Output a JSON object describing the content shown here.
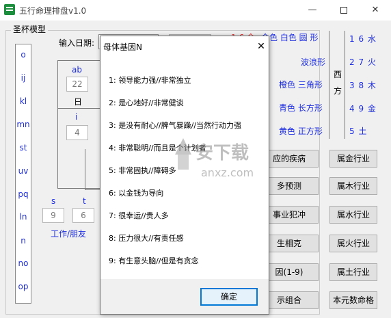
{
  "window": {
    "title": "五行命理排盘v1.0",
    "min_glyph": "—",
    "close_glyph": "✕"
  },
  "model_group": {
    "title": "圣杯模型",
    "left_items": [
      "o",
      "ij",
      "kl",
      "mn",
      "st",
      "uv",
      "pq",
      "ln",
      "n",
      "no",
      "op"
    ]
  },
  "date": {
    "label": "输入日期:"
  },
  "red_text": "1 6 金",
  "calc": {
    "ab_label": "ab",
    "ab_value": "22",
    "day_label": "日",
    "i_label": "i",
    "i_value": "4",
    "s_label": "s",
    "t_label": "t",
    "s_value": "9",
    "t_value": "6",
    "work_label": "工作/朋友"
  },
  "colors": [
    {
      "text": "白色  圆 形",
      "marker": "金色"
    },
    {
      "text": "波浪形"
    },
    {
      "text": "橙色  三角形"
    },
    {
      "text": "青色  长方形"
    },
    {
      "text": "黄色  正方形"
    }
  ],
  "west": [
    "西",
    "方"
  ],
  "elements": [
    "1 6 水",
    "2 7 火",
    "3 8 木",
    "4 9 金",
    "5  土"
  ],
  "side_buttons": [
    {
      "left": "应的疾病",
      "right": "属金行业"
    },
    {
      "left": "多预测",
      "right": "属木行业"
    },
    {
      "left": "事业犯冲",
      "right": "属水行业"
    },
    {
      "left": "生相克",
      "right": "属火行业"
    },
    {
      "left": "因(1-9)",
      "right": "属土行业"
    },
    {
      "left": "示组合",
      "right": "本元数命格"
    }
  ],
  "dialog": {
    "title": "母体基因N",
    "close_glyph": "✕",
    "lines": [
      "1:  领导能力强//非常独立",
      "2:  是心地好//非常健谈",
      "3:  是没有耐心//脾气暴躁//当然行动力强",
      "4:  非常聪明//而且是个计划者",
      "5:  非常固执//障碍多",
      "6:  以金钱为导向",
      "7:  很幸运//贵人多",
      "8:  压力很大//有责任感",
      "9:  有生意头脑//但是有贪念"
    ],
    "ok_label": "确定"
  },
  "watermark": {
    "text": "安下载",
    "domain": "anxz.com"
  }
}
